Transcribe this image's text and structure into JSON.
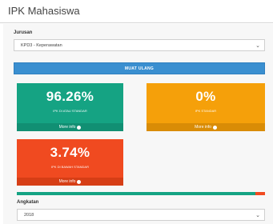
{
  "page": {
    "title": "IPK Mahasiswa"
  },
  "filters": {
    "jurusan_label": "Jurusan",
    "jurusan_value": "KPD3 - Keperawatan",
    "reload_button": "MUAT ULANG",
    "angkatan_label": "Angkatan",
    "angkatan_value": "2018"
  },
  "stats": [
    {
      "value": "96.26%",
      "caption": "IPK DI ATAU STANDAR",
      "more": "More info",
      "color": "#15a383"
    },
    {
      "value": "0%",
      "caption": "IPK STANDAR",
      "more": "More info",
      "color": "#f5a00a"
    },
    {
      "value": "3.74%",
      "caption": "IPK DI BAWAH STANDAR",
      "more": "More info",
      "color": "#f04a20"
    }
  ],
  "progress": {
    "above_standard_pct": 96.26,
    "standard_pct": 0,
    "below_standard_pct": 3.74
  },
  "icons": {
    "select": "chevron-down-icon",
    "more_info": "arrow-circle-right-icon"
  }
}
